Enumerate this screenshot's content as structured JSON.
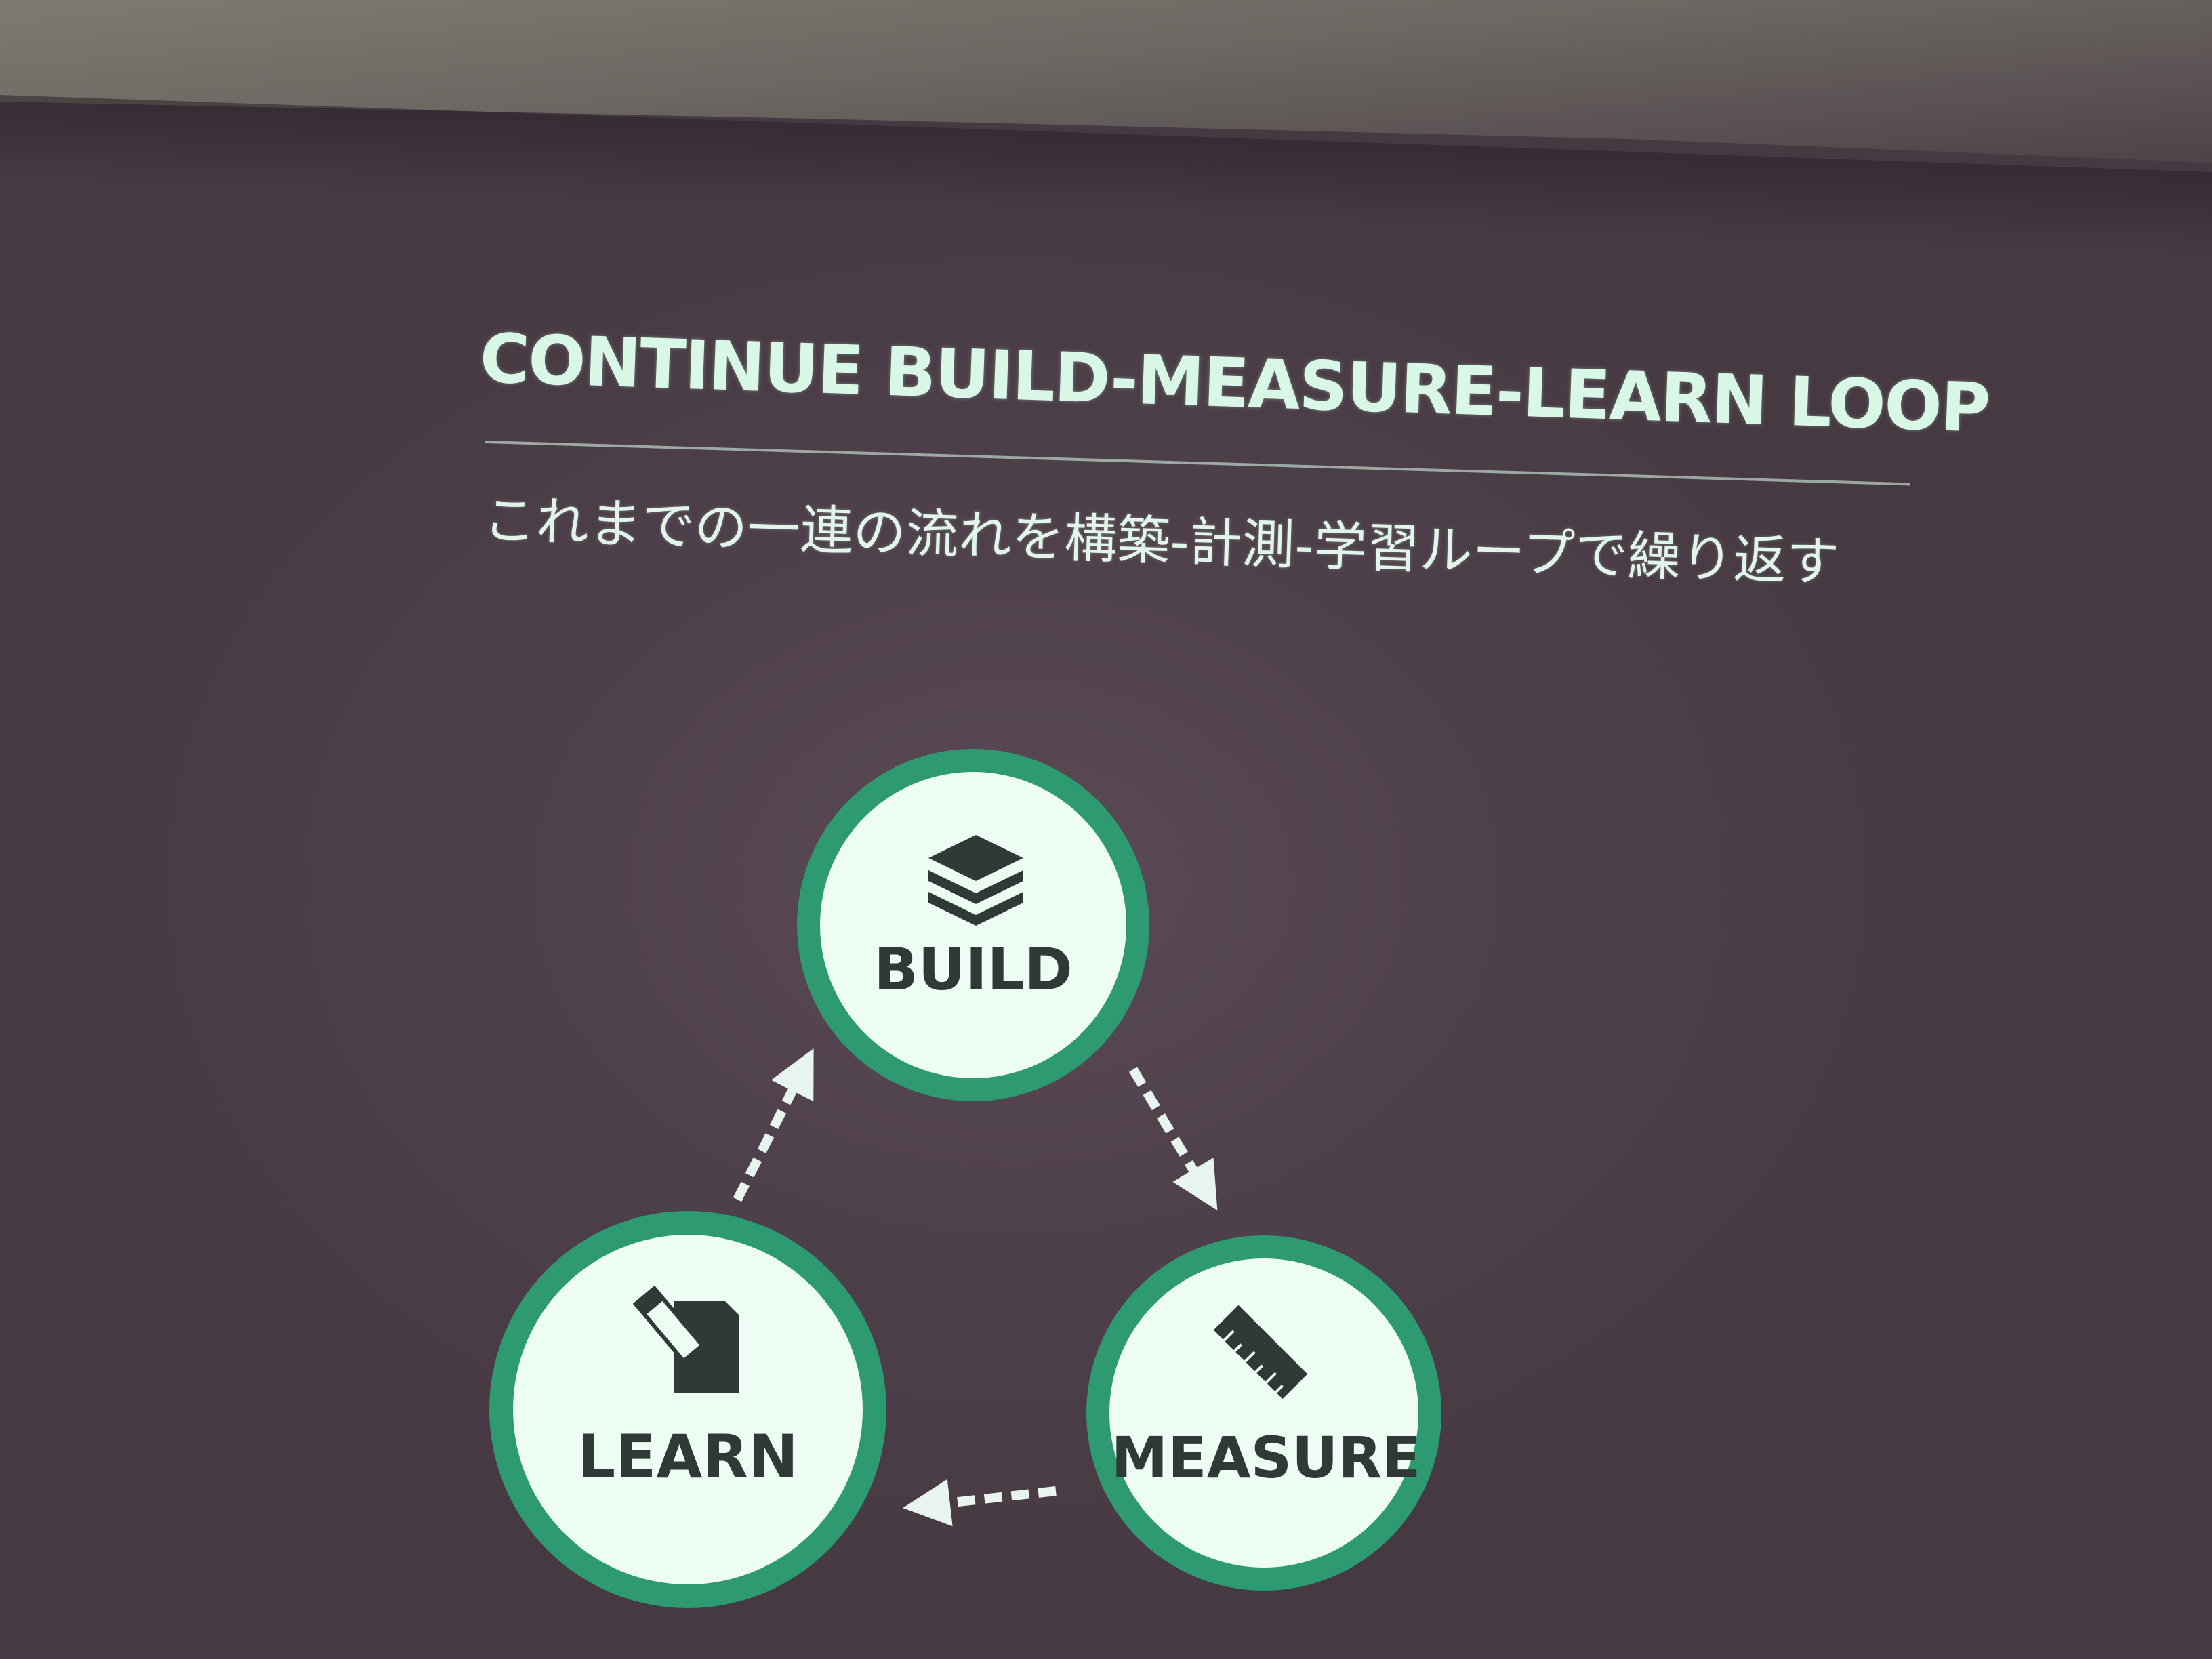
{
  "slide": {
    "title": "CONTINUE BUILD-MEASURE-LEARN LOOP",
    "subtitle": "これまでの一連の流れを構築-計測-学習ループで繰り返す"
  },
  "diagram": {
    "nodes": [
      {
        "id": "build",
        "label": "BUILD",
        "icon": "layers-icon"
      },
      {
        "id": "measure",
        "label": "MEASURE",
        "icon": "ruler-icon"
      },
      {
        "id": "learn",
        "label": "LEARN",
        "icon": "notepad-pen-icon"
      }
    ],
    "flow": [
      "build",
      "measure",
      "learn",
      "build"
    ]
  },
  "colors": {
    "background": "#4f414b",
    "title_text": "#d9f7e7",
    "circle_ring": "#2e9a72",
    "circle_fill": "#eefdf4",
    "node_text": "#2f3a36",
    "arrow": "#e8f5ee"
  }
}
